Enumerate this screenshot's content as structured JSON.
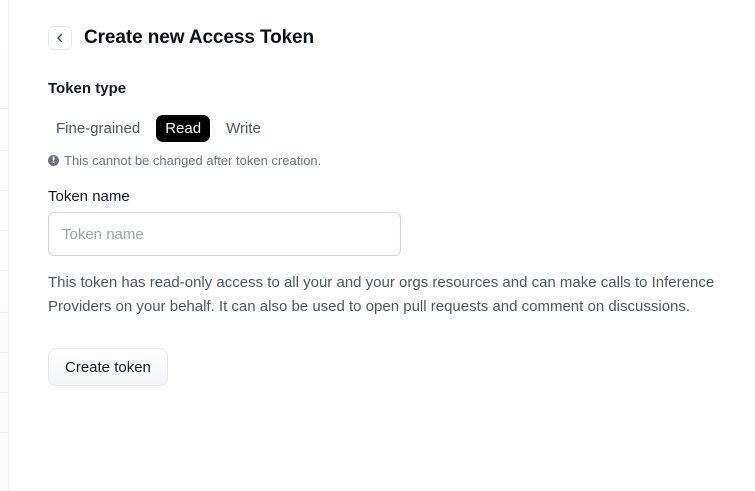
{
  "header": {
    "title": "Create new Access Token",
    "back_icon": "chevron-left-icon"
  },
  "token_type": {
    "label": "Token type",
    "tabs": [
      {
        "label": "Fine-grained",
        "active": false
      },
      {
        "label": "Read",
        "active": true
      },
      {
        "label": "Write",
        "active": false
      }
    ],
    "note": "This cannot be changed after token creation.",
    "note_icon": "info-icon"
  },
  "token_name": {
    "label": "Token name",
    "placeholder": "Token name",
    "value": ""
  },
  "description": "This token has read-only access to all your and your orgs resources and can make calls to Inference Providers on your behalf. It can also be used to open pull requests and comment on discussions.",
  "actions": {
    "create_label": "Create token"
  },
  "colors": {
    "active_tab_bg": "#000000",
    "active_tab_text": "#ffffff",
    "muted_text": "#6b7280"
  }
}
